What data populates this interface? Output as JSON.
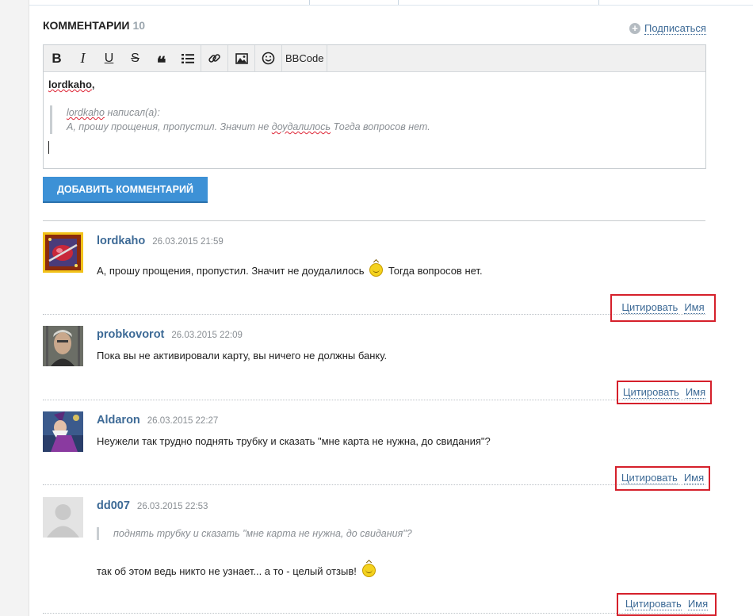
{
  "comments_header": {
    "title": "КОММЕНТАРИИ",
    "count": "10"
  },
  "subscribe": {
    "label": "Подписаться"
  },
  "toolbar": {
    "bbcode_label": "BBCode"
  },
  "editor": {
    "reply_to": "lordkaho,",
    "quote_author": "lordkaho",
    "quote_wrote": "написал(а):",
    "quote_text_a": "А, прошу прощения, пропустил. Значит не ",
    "quote_text_b": "доудалилось",
    "quote_text_c": " Тогда вопросов нет."
  },
  "add_button": {
    "label": "ДОБАВИТЬ КОММЕНТАРИЙ"
  },
  "comments": [
    {
      "author": "lordkaho",
      "date": "26.03.2015 21:59",
      "text_a": "А, прошу прощения, пропустил. Значит не доудалилось",
      "text_b": "Тогда вопросов нет.",
      "quote_label": "Цитировать",
      "name_label": "Имя"
    },
    {
      "author": "probkovorot",
      "date": "26.03.2015 22:09",
      "text": "Пока вы не активировали карту, вы ничего не должны банку.",
      "quote_label": "Цитировать",
      "name_label": "Имя"
    },
    {
      "author": "Aldaron",
      "date": "26.03.2015 22:27",
      "text": "Неужели так трудно поднять трубку и сказать \"мне карта не нужна, до свидания\"?",
      "quote_label": "Цитировать",
      "name_label": "Имя"
    },
    {
      "author": "dd007",
      "date": "26.03.2015 22:53",
      "quote": "поднять трубку и сказать \"мне карта не нужна, до свидания\"?",
      "text": "так об этом ведь никто не узнает... а то - целый отзыв!",
      "quote_label": "Цитировать",
      "name_label": "Имя"
    }
  ]
}
